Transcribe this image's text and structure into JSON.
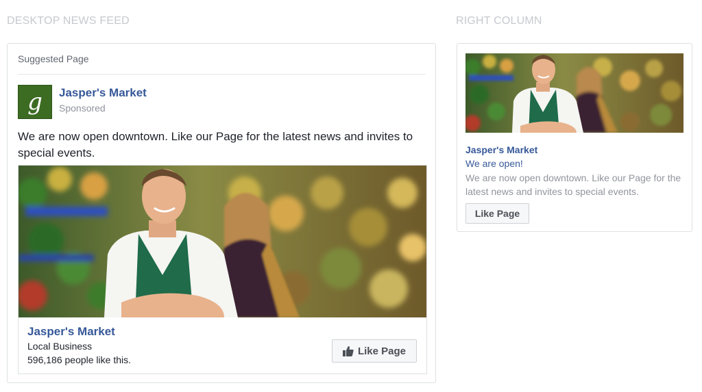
{
  "sections": {
    "feed_title": "DESKTOP NEWS FEED",
    "right_title": "RIGHT COLUMN"
  },
  "feed_post": {
    "header": "Suggested Page",
    "page_name": "Jasper's Market",
    "sponsored": "Sponsored",
    "text": "We are now open downtown. Like our Page for the latest news and invites to special events.",
    "logo_letter": "g",
    "footer": {
      "page_name": "Jasper's Market",
      "category": "Local Business",
      "likes": "596,186 people like this.",
      "like_button": "Like Page"
    }
  },
  "right_ad": {
    "page_name": "Jasper's Market",
    "headline": "We are open!",
    "description": "We are now open downtown. Like our Page for the latest news and invites to special events.",
    "like_button": "Like Page"
  },
  "colors": {
    "link_blue": "#365899",
    "logo_green": "#3c6b22",
    "muted_text": "#90949c",
    "section_title": "#c6c9cf"
  },
  "icons": {
    "thumbs_up": "thumbs-up-icon",
    "logo": "jaspers-market-logo"
  }
}
